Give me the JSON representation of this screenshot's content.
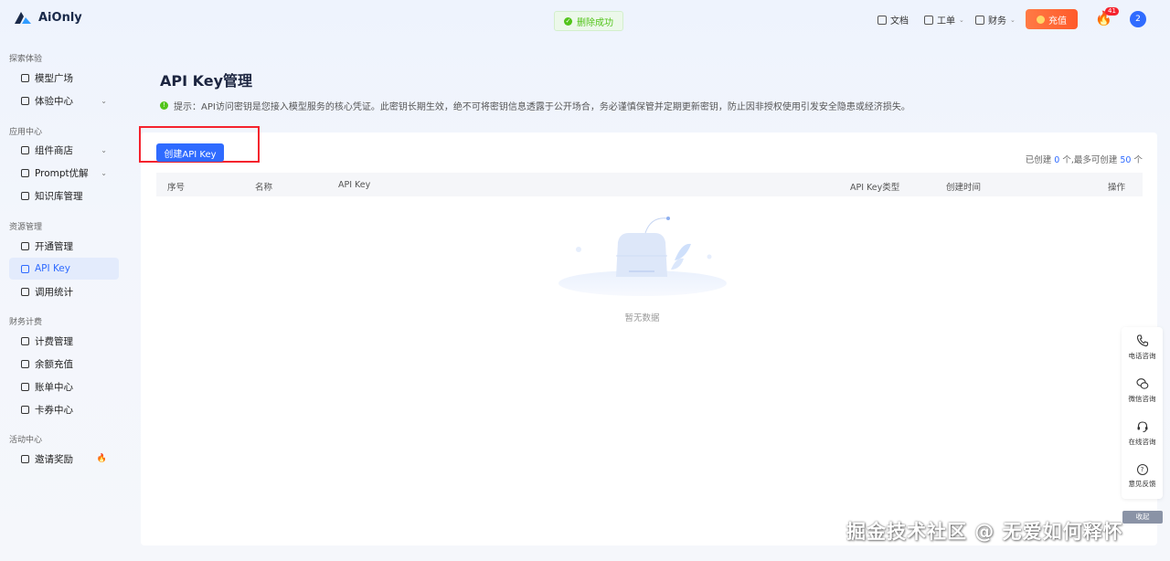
{
  "app": {
    "logo_text": "AiOnly"
  },
  "toast": {
    "text": "删除成功"
  },
  "header": {
    "docs": "文档",
    "ticket": "工单",
    "finance": "财务",
    "recharge": "充值",
    "fire_badge": "41",
    "avatar": "2"
  },
  "sidebar": {
    "sections": [
      {
        "title": "探索体验"
      },
      {
        "title": "应用中心"
      },
      {
        "title": "资源管理"
      },
      {
        "title": "财务计费"
      },
      {
        "title": "活动中心"
      }
    ],
    "items": [
      {
        "label": "模型广场"
      },
      {
        "label": "体验中心"
      },
      {
        "label": "组件商店"
      },
      {
        "label": "Prompt优解"
      },
      {
        "label": "知识库管理"
      },
      {
        "label": "开通管理"
      },
      {
        "label": "API Key"
      },
      {
        "label": "调用统计"
      },
      {
        "label": "计费管理"
      },
      {
        "label": "余额充值"
      },
      {
        "label": "账单中心"
      },
      {
        "label": "卡券中心"
      },
      {
        "label": "邀请奖励"
      }
    ],
    "active_item": "API Key"
  },
  "main": {
    "title": "API Key管理",
    "tip": "提示：API访问密钥是您接入模型服务的核心凭证。此密钥长期生效，绝不可将密钥信息透露于公开场合，务必谨慎保管并定期更新密钥，防止因非授权使用引发安全隐患或经济损失。",
    "create_button": "创建API Key",
    "quota": {
      "prefix": "已创建 ",
      "created": "0",
      "middle": " 个,最多可创建 ",
      "max": "50",
      "suffix": " 个"
    },
    "table": {
      "headers": [
        "序号",
        "名称",
        "API Key",
        "API Key类型",
        "创建时间",
        "操作"
      ],
      "rows": []
    },
    "empty_text": "暂无数据"
  },
  "float_panel": {
    "items": [
      {
        "label": "电话咨询",
        "icon": "phone-icon"
      },
      {
        "label": "微信咨询",
        "icon": "wechat-icon"
      },
      {
        "label": "在线咨询",
        "icon": "headset-icon"
      },
      {
        "label": "意见反馈",
        "icon": "question-icon"
      }
    ],
    "collapse": "收起"
  },
  "watermark": "掘金技术社区 @ 无爱如何释怀",
  "colors": {
    "primary": "#2f6bff",
    "success": "#52c41a",
    "danger": "#f5222d",
    "recharge": "#ff5a2a"
  }
}
